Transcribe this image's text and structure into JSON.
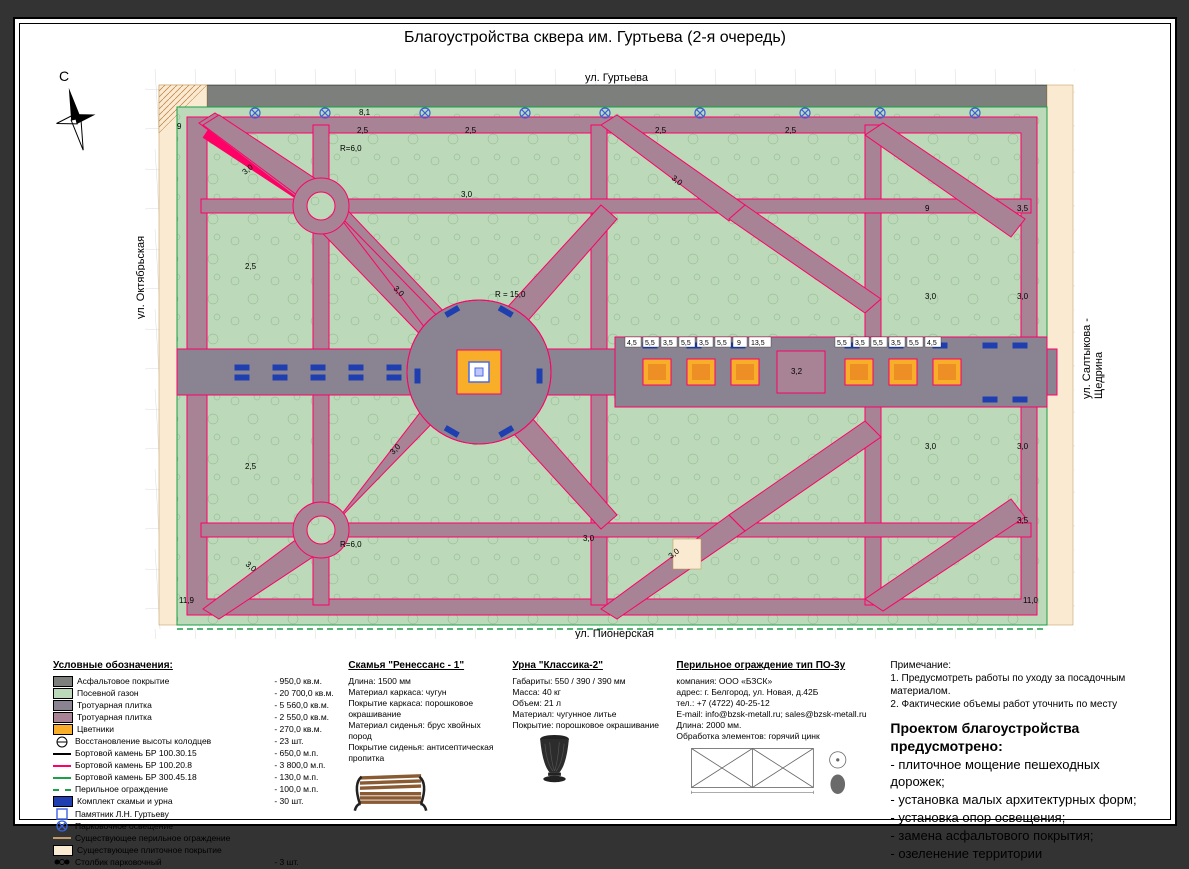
{
  "title": "Благоустройства сквера им. Гуртьева (2-я очередь)",
  "streets": {
    "north": "ул. Гуртьева",
    "south": "ул. Пионерская",
    "west": "ул. Октябрьская",
    "east": "ул. Салтыкова - Щедрина"
  },
  "radii": {
    "small": "R=6,0",
    "big": "R = 15,0"
  },
  "dims": {
    "top_segments": [
      "2,5",
      "2,5",
      "2,5",
      "2,5"
    ],
    "bottom_mid": "3,0",
    "left2": "2,5",
    "diag1": "3,0",
    "diag2": "3,0",
    "diag3": "3,0",
    "diag4": "3,0",
    "right_col": [
      "3,5",
      "3,0",
      "3,0",
      "3,5"
    ],
    "right_inner": [
      "9",
      "3,0",
      "3,0"
    ],
    "plaza_seq": [
      "4,5",
      "5,5",
      "3,5",
      "5,5",
      "3,5",
      "5,5",
      "9",
      "13,5",
      "5,5",
      "3,5",
      "5,5",
      "3,5",
      "5,5",
      "4,5"
    ],
    "plaza_mid": "3,2",
    "sw_len": "11,9",
    "se_len": "11,0",
    "nw_h": "9",
    "nw_b1": "8,1"
  },
  "compass_letter": "С",
  "legend": {
    "header": "Условные обозначения:",
    "items": [
      {
        "type": "swatch",
        "fill": "#7c7f7c",
        "label": "Асфальтовое покрытие",
        "qty": "- 950,0 кв.м."
      },
      {
        "type": "swatch",
        "fill": "#bcd9ba",
        "label": "Посевной газон",
        "qty": "- 20 700,0 кв.м."
      },
      {
        "type": "swatch",
        "fill": "#8a8492",
        "label": "Тротуарная плитка",
        "qty": "- 5 560,0 кв.м."
      },
      {
        "type": "swatch",
        "fill": "#a88295",
        "label": "Тротуарная плитка",
        "qty": "- 2 550,0 кв.м."
      },
      {
        "type": "swatch",
        "fill": "#f9ae2a",
        "label": "Цветники",
        "qty": "- 270,0 кв.м."
      },
      {
        "type": "sym",
        "sym": "well",
        "label": "Восстановление высоты колодцев",
        "qty": "- 23 шт."
      },
      {
        "type": "line",
        "color": "#000",
        "label": "Бортовой камень БР 100.30.15",
        "qty": "- 650,0 м.п."
      },
      {
        "type": "line",
        "color": "#ff0066",
        "label": "Бортовой камень БР 100.20.8",
        "qty": "- 3 800,0 м.п."
      },
      {
        "type": "line",
        "color": "#1aa046",
        "label": "Бортовой камень БР 300.45.18",
        "qty": "- 130,0 м.п."
      },
      {
        "type": "dash",
        "color": "#1aa046",
        "label": "Перильное ограждение",
        "qty": "- 100,0 м.п."
      },
      {
        "type": "swatch",
        "fill": "#1f3fb0",
        "label": "Комплект скамьи и урна",
        "qty": "- 30 шт."
      },
      {
        "type": "sym",
        "sym": "monument",
        "label": "Памятник Л.Н. Гуртьеву",
        "qty": ""
      },
      {
        "type": "sym",
        "sym": "light",
        "label": "Парковочное освещение",
        "qty": ""
      },
      {
        "type": "line",
        "color": "#c49a6b",
        "label": "Существующее перильное ограждение",
        "qty": ""
      },
      {
        "type": "swatch",
        "fill": "#faead1",
        "label": "Существующее плиточное покрытие",
        "qty": ""
      },
      {
        "type": "sym",
        "sym": "post",
        "label": "Столбик парковочный",
        "qty": "- 3 шт."
      }
    ]
  },
  "bench": {
    "title": "Скамья \"Ренессанс - 1\"",
    "lines": [
      "Длина: 1500 мм",
      "Материал каркаса: чугун",
      "Покрытие каркаса: порошковое окрашивание",
      "Материал сиденья: брус хвойных пород",
      "Покрытие сиденья: антисептическая пропитка"
    ]
  },
  "urn": {
    "title": "Урна \"Классика-2\"",
    "lines": [
      "Габариты: 550 / 390 / 390 мм",
      "Масса: 40 кг",
      "Объем: 21 л",
      "Материал: чугунное литье",
      "Покрытие: порошковое окрашивание"
    ]
  },
  "railing_spec": {
    "title": "Перильное ограждение тип ПО-3у",
    "lines": [
      "компания: ООО «БЗСК»",
      "адрес: г. Белгород, ул. Новая, д.42Б",
      "тел.: +7 (4722) 40-25-12",
      "E-mail: info@bzsk-metall.ru; sales@bzsk-metall.ru",
      "Длина: 2000 мм.",
      "Обработка элементов: горячий цинк"
    ]
  },
  "notes": {
    "title": "Примечание:",
    "items": [
      "1. Предусмотреть работы по уходу за посадочным материалом.",
      "2. Фактические объемы работ уточнить по месту"
    ]
  },
  "scope": {
    "title": "Проектом благоустройства предусмотрено:",
    "items": [
      "- плиточное мощение пешеходных дорожек;",
      "- установка малых архитектурных форм;",
      "- установка опор освещения;",
      "- замена асфальтового покрытия;",
      "- озеленение территории"
    ]
  }
}
